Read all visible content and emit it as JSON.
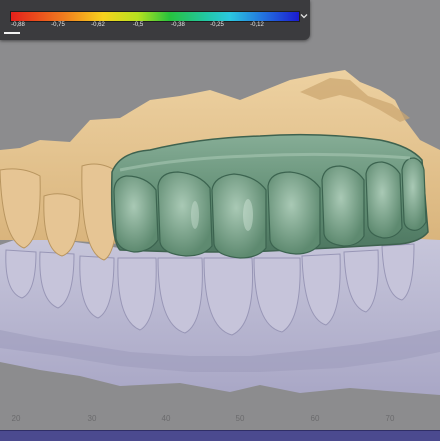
{
  "legend": {
    "tick_labels": [
      "-0,88",
      "-0,75",
      "-0,62",
      "-0,5",
      "-0,38",
      "-0,25",
      "-0,12"
    ],
    "collapse_icon": "chevron-down-icon"
  },
  "ruler": {
    "labels": [
      "20",
      "30",
      "40",
      "50",
      "60",
      "70"
    ]
  },
  "colors": {
    "background": "#8c8c8e",
    "maxilla_model": "#e2bf8a",
    "mandible_model": "#b8b6d2",
    "crown_bridge": "#6e9a80",
    "status_bar": "#4b4a8f"
  }
}
